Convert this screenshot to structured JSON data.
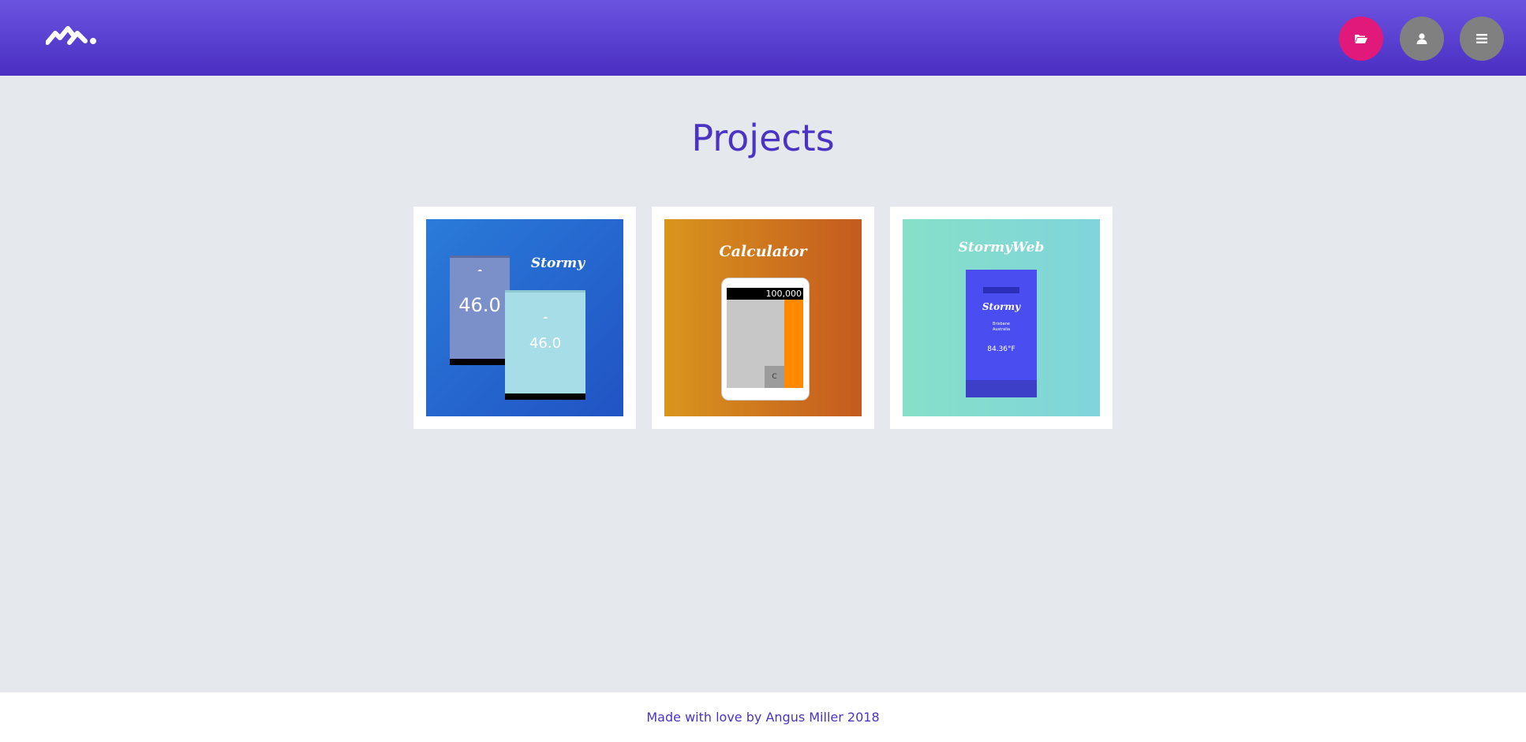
{
  "header": {
    "logo_name": "site-logo",
    "nav": [
      {
        "name": "projects",
        "icon": "folder-open-icon"
      },
      {
        "name": "about",
        "icon": "user-icon"
      },
      {
        "name": "menu",
        "icon": "hamburger-menu-icon"
      }
    ]
  },
  "main": {
    "title": "Projects",
    "projects": [
      {
        "title": "Stormy",
        "phone_temp_1": "46.0",
        "phone_temp_2": "46.0"
      },
      {
        "title": "Calculator",
        "display": "100,000",
        "clear_key": "C"
      },
      {
        "title": "StormyWeb",
        "app_title": "Stormy",
        "location_line1": "Brisbane",
        "location_line2": "Australia",
        "temperature": "84.36°F"
      }
    ]
  },
  "footer": {
    "text": "Made with love by Angus Miller 2018"
  },
  "colors": {
    "header_top": "#6b54e0",
    "header_bottom": "#4a2ec2",
    "accent": "#4b33c4",
    "projects_button": "#e0197a",
    "nav_button_gray": "#808080",
    "background": "#e5e9ee"
  }
}
